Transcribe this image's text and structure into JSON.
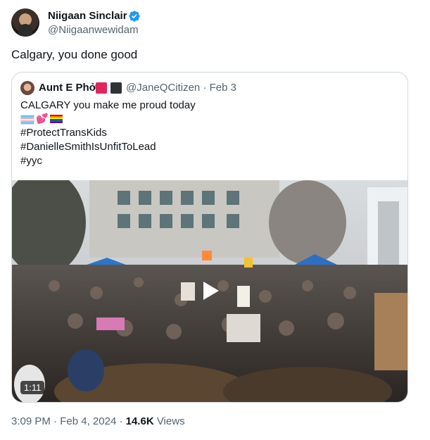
{
  "author": {
    "name": "Niigaan Sinclair",
    "handle": "@Niigaanwewidam",
    "verified_color": "#1d9bf0"
  },
  "tweet": {
    "text": "Calgary, you done good"
  },
  "quote": {
    "name": "Aunt E Phở",
    "handle_date": "@JaneQCitizen · Feb 3",
    "line1": "CALGARY you make me proud today",
    "emoji_hearts": "💕",
    "line3": "#ProtectTransKids",
    "line4": "#DanielleSmithIsUnfitToLead",
    "line5": "#yyc",
    "video_duration": "1:11"
  },
  "meta": {
    "time": "3:09 PM",
    "sep1": " · ",
    "date": "Feb 4, 2024",
    "sep2": " · ",
    "views_count": "14.6K",
    "views_label": " Views"
  },
  "colors": {
    "text": "#0f1419",
    "secondary": "#536471",
    "border": "#cfd9de"
  }
}
